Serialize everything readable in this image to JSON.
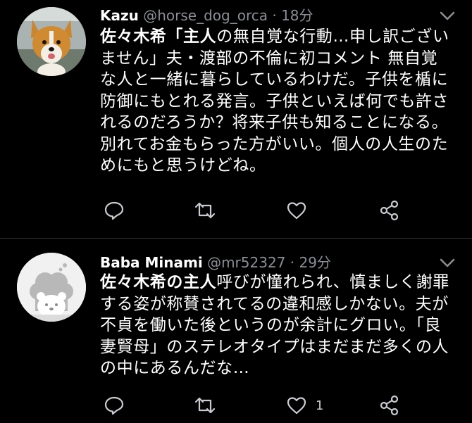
{
  "colors": {
    "background": "#000000",
    "text": "#ffffff",
    "muted": "#8a8f94",
    "icon": "#c8ccd0",
    "divider": "#2f3336"
  },
  "tweets": [
    {
      "name": "Kazu",
      "handle": "@horse_dog_orca",
      "separator": "·",
      "time": "18分",
      "avatar_icon": "dog-photo-avatar",
      "text_bold": "佐々木希「主人",
      "text_rest": "の無自覚な行動…申し訳ございません」夫・渡部の不倫に初コメント 無自覚な人と一緒に暮らしているわけだ。子供を楯に防御にもとれる発言。子供といえば何でも許されるのだろうか？将来子供も知ることになる。別れてお金もらった方がいい。個人の人生のためにもと思うけどね。",
      "reply_count": "",
      "retweet_count": "",
      "like_count": ""
    },
    {
      "name": "Baba Minami",
      "handle": "@mr52327",
      "separator": "·",
      "time": "29分",
      "avatar_icon": "dog-illustration-avatar",
      "text_bold": "佐々木希の主人",
      "text_rest": "呼びが憧れられ、慎ましく謝罪する姿が称賛されてるの違和感しかない。夫が不貞を働いた後というのが余計にグロい。「良妻賢母」のステレオタイプはまだまだ多くの人の中にあるんだな…",
      "reply_count": "",
      "retweet_count": "",
      "like_count": "1"
    }
  ]
}
